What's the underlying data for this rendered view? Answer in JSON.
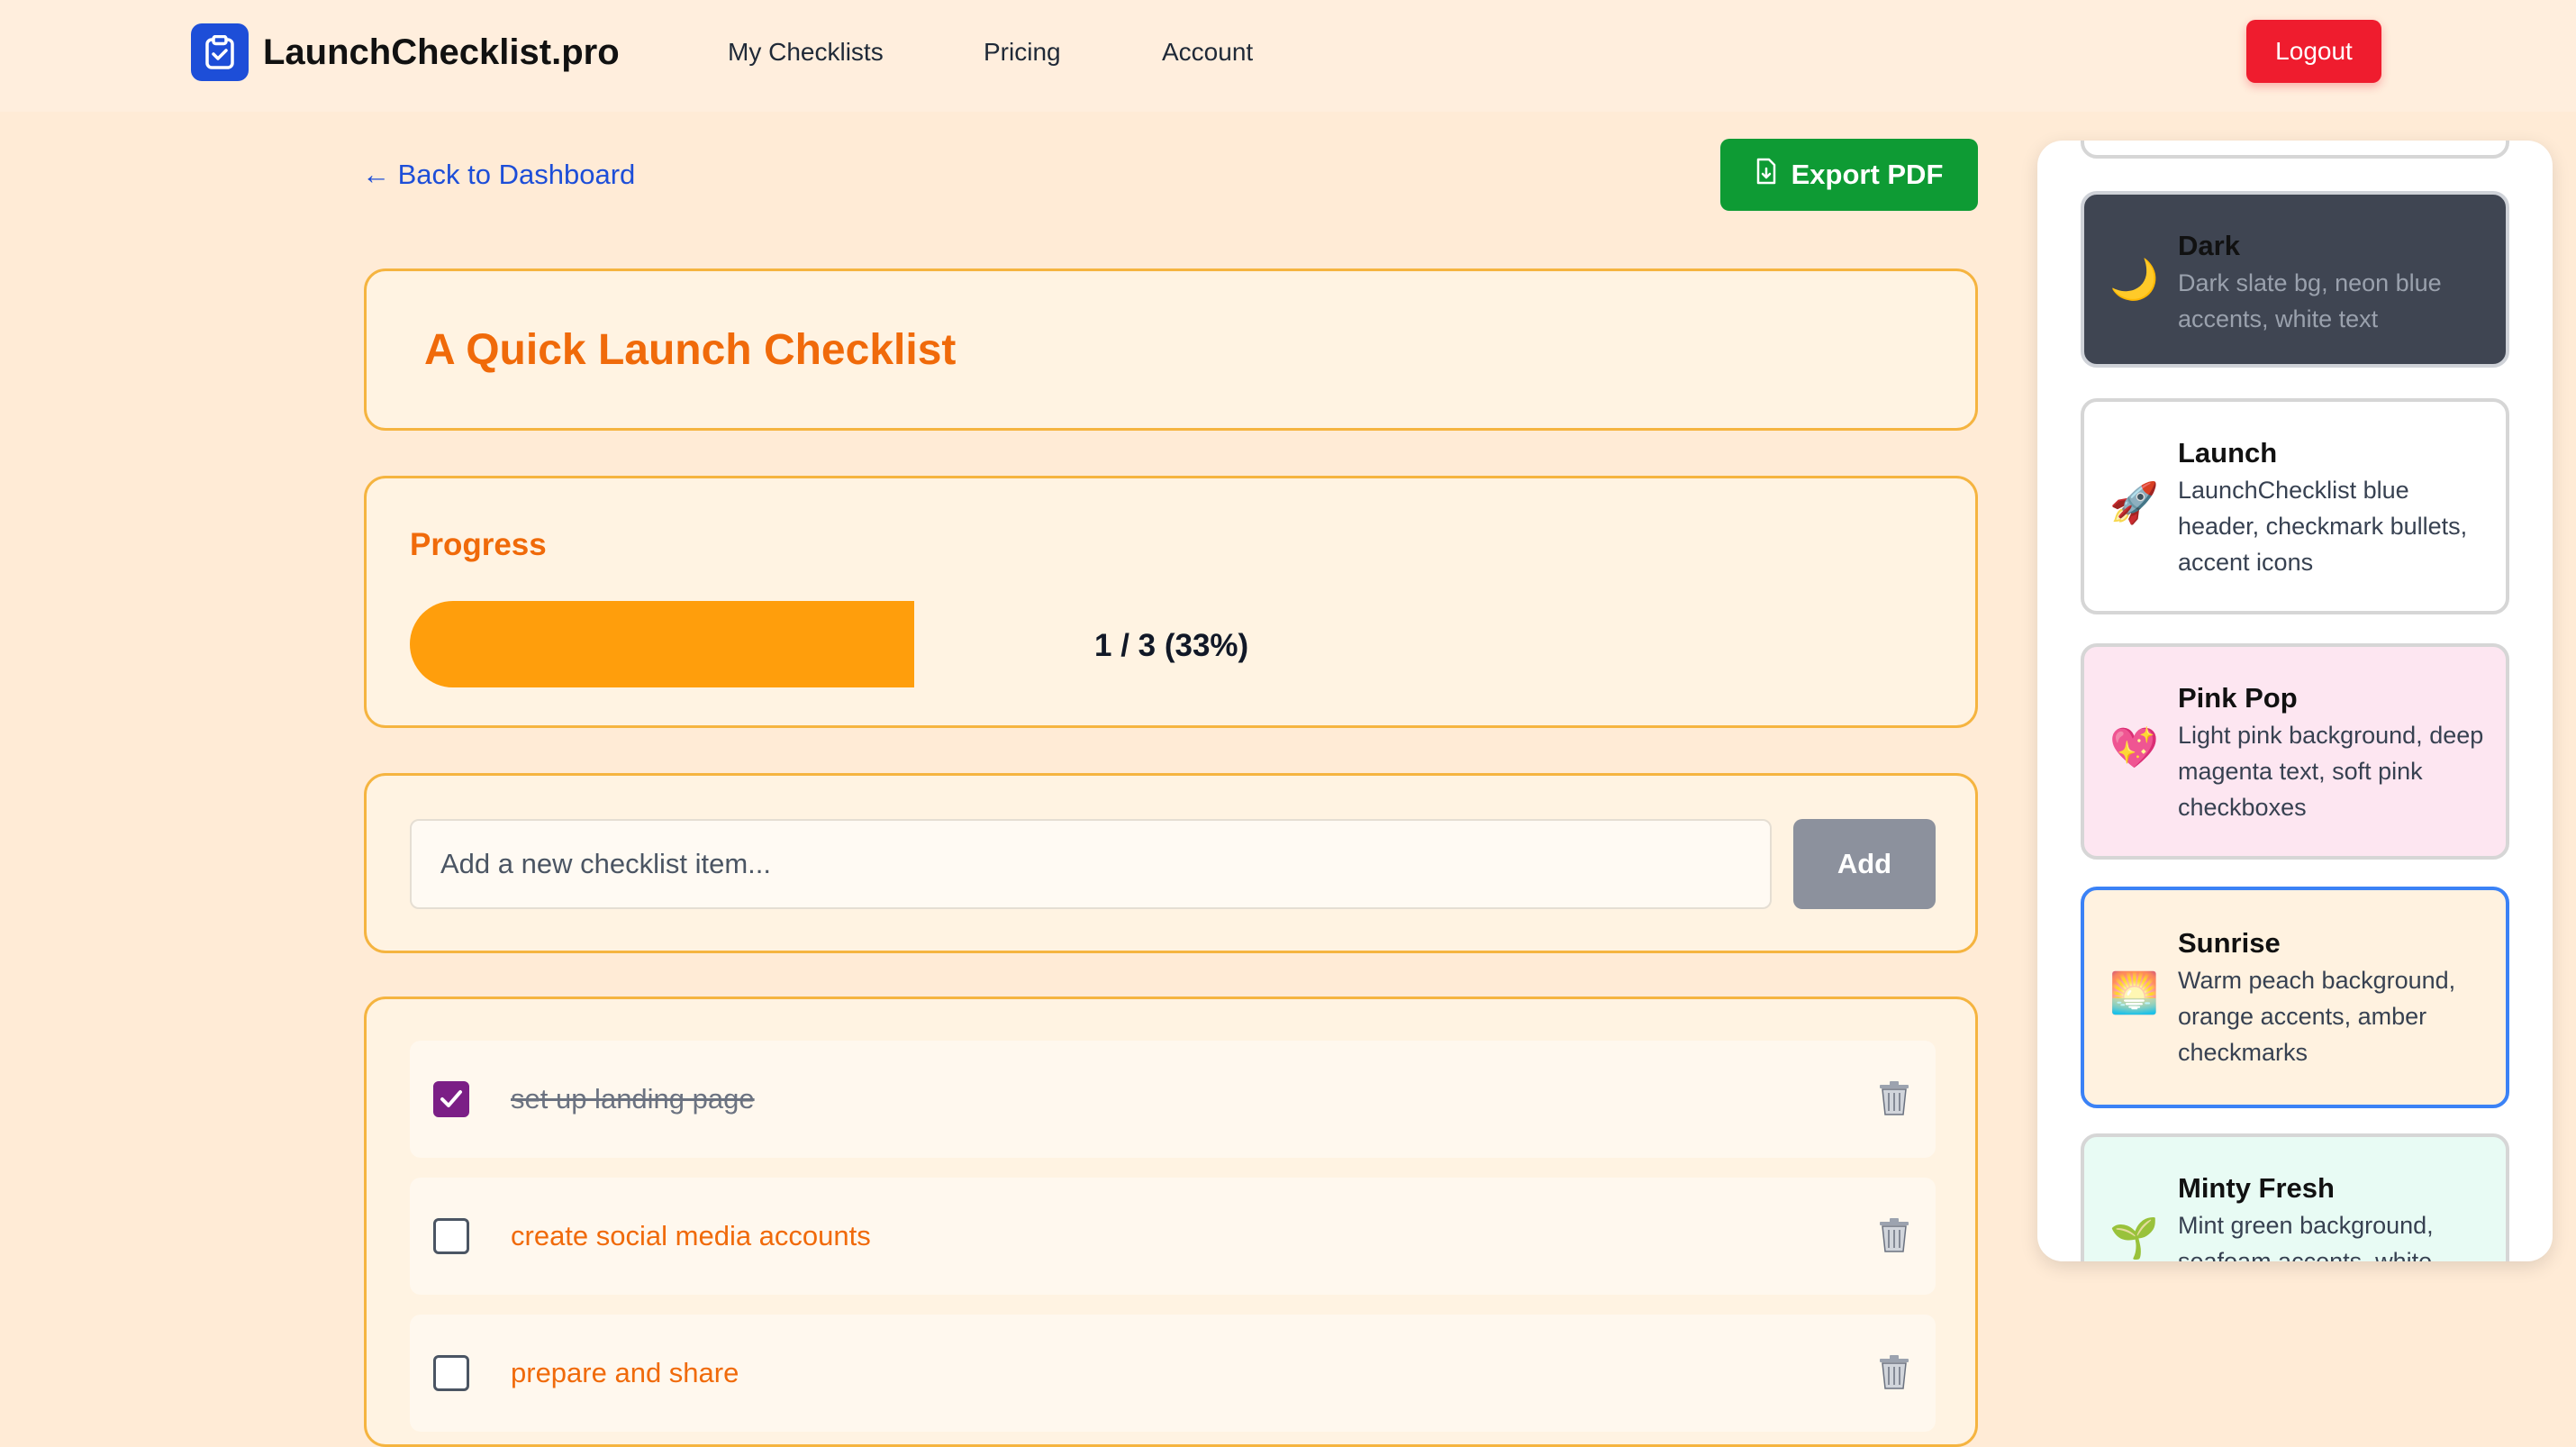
{
  "app": {
    "name": "LaunchChecklist.pro",
    "nav": [
      "My Checklists",
      "Pricing",
      "Account"
    ],
    "logout": "Logout"
  },
  "toolbar": {
    "back": "← Back to Dashboard",
    "export": "Export PDF"
  },
  "checklist": {
    "title": "A Quick Launch Checklist",
    "progress_label": "Progress",
    "progress_text": "1 / 3 (33%)",
    "progress_fraction": 0.333,
    "add_placeholder": "Add a new checklist item...",
    "add_label": "Add",
    "items": [
      {
        "text": "set up landing page",
        "checked": true
      },
      {
        "text": "create social media accounts",
        "checked": false
      },
      {
        "text": "prepare and share",
        "checked": false
      }
    ]
  },
  "themes": [
    {
      "name": "Dark",
      "desc": "Dark slate bg, neon blue accents, white text",
      "icon": "🌙"
    },
    {
      "name": "Launch",
      "desc": "LaunchChecklist blue header, checkmark bullets, accent icons",
      "icon": "🚀"
    },
    {
      "name": "Pink Pop",
      "desc": "Light pink background, deep magenta text, soft pink checkboxes",
      "icon": "💖"
    },
    {
      "name": "Sunrise",
      "desc": "Warm peach background, orange accents, amber checkmarks",
      "icon": "🌅"
    },
    {
      "name": "Minty Fresh",
      "desc": "Mint green background, seafoam accents, white",
      "icon": "🌱"
    }
  ],
  "colors": {
    "accent": "#f06a0a",
    "progress": "#ff9e0c",
    "export": "#0e9b34",
    "logout": "#ef1c2e",
    "link": "#1d4ed8",
    "checked": "#7b1f86"
  }
}
